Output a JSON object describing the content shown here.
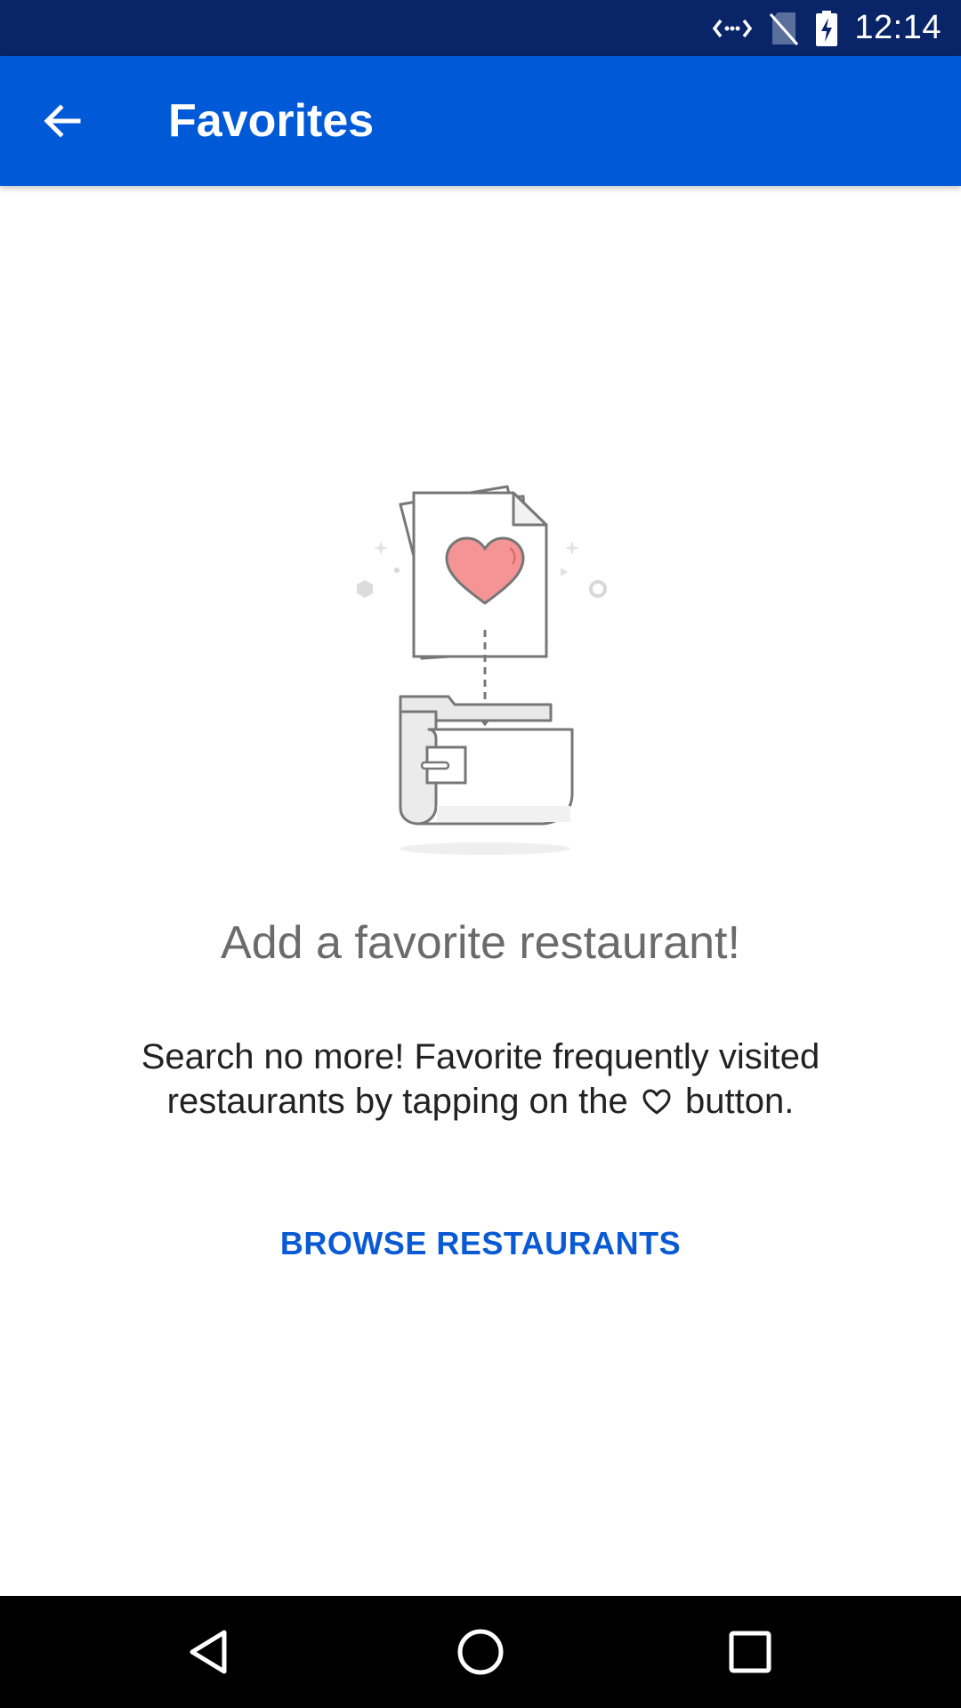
{
  "status_bar": {
    "time": "12:14",
    "icons": [
      "data-arrows-icon",
      "no-sim-icon",
      "battery-charging-icon"
    ]
  },
  "app_bar": {
    "title": "Favorites",
    "back_icon": "arrow-back-icon"
  },
  "empty_state": {
    "illustration": "heart-document-into-folder-illustration",
    "title": "Add a favorite restaurant!",
    "body_line1": "Search no more! Favorite frequently visited",
    "body_line2_before": "restaurants by tapping on the",
    "body_line2_after": "button.",
    "inline_icon": "heart-outline-icon",
    "action_label": "BROWSE RESTAURANTS"
  },
  "nav_bar": {
    "icons": [
      "back-triangle-icon",
      "home-circle-icon",
      "recents-square-icon"
    ]
  },
  "colors": {
    "status_bar": "#0a2468",
    "app_bar": "#005ad8",
    "accent": "#0a5ad4",
    "heart": "#f28b8b"
  }
}
